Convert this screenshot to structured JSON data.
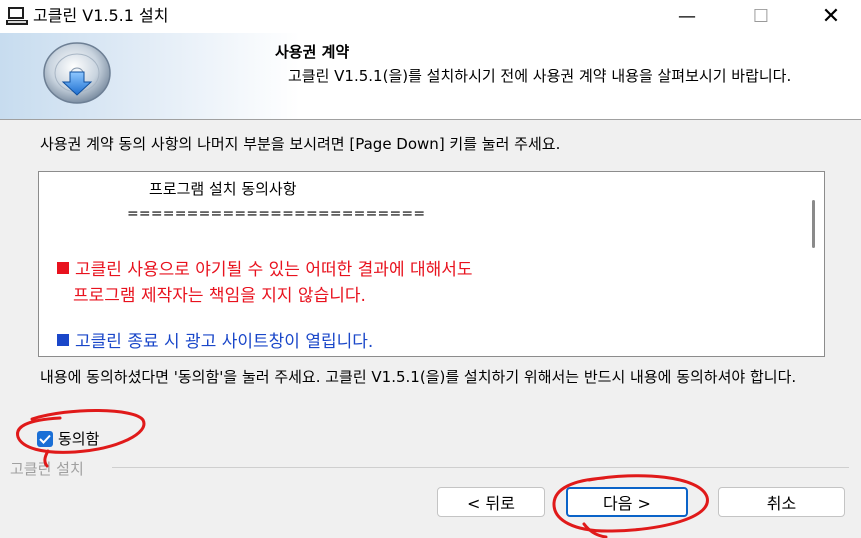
{
  "window": {
    "title": "고클린 V1.5.1 설치",
    "minimize": "—",
    "maximize": "☐",
    "close": "✕"
  },
  "header": {
    "title": "사용권 계약",
    "subtitle": "고클린 V1.5.1(을)를 설치하시기 전에 사용권 계약 내용을 살펴보시기 바랍니다."
  },
  "instruction": "사용권 계약 동의 사항의 나머지 부분을 보시려면 [Page Down] 키를 눌러 주세요.",
  "license": {
    "heading": "프로그램 설치 동의사항",
    "rule": "=========================",
    "item1_line1": "고클린 사용으로 야기될 수 있는 어떠한 결과에 대해서도",
    "item1_line2": "프로그램 제작자는 책임을 지지 않습니다.",
    "item2": "고클린 종료 시 광고 사이트창이 열립니다.",
    "colors": {
      "red": "#e8121e",
      "blue": "#1a47c9"
    }
  },
  "agree_text": "내용에 동의하셨다면 '동의함'을 눌러 주세요. 고클린 V1.5.1(을)를 설치하기 위해서는 반드시 내용에 동의하셔야 합니다.",
  "checkbox": {
    "label": "동의함",
    "checked": true
  },
  "group_label": "고클린 설치",
  "buttons": {
    "back": "< 뒤로",
    "next": "다음 >",
    "cancel": "취소"
  },
  "accent_color": "#0a63c8",
  "annotation_color": "#e01a1a"
}
